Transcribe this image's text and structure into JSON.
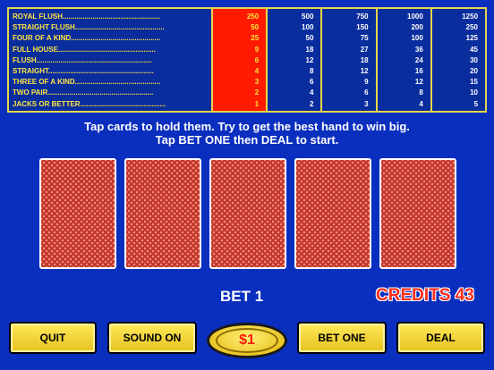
{
  "paytable": {
    "hands": [
      "ROYAL FLUSH.................................................",
      "STRAIGHT FLUSH.............................................",
      "FOUR OF A KIND.............................................",
      "FULL HOUSE.................................................",
      "FLUSH..........................................................",
      "STRAIGHT.....................................................",
      "THREE OF A KIND...........................................",
      "TWO PAIR.....................................................",
      "JACKS OR BETTER..........................................."
    ],
    "columns": [
      [
        "250",
        "50",
        "25",
        "9",
        "6",
        "4",
        "3",
        "2",
        "1"
      ],
      [
        "500",
        "100",
        "50",
        "18",
        "12",
        "8",
        "6",
        "4",
        "2"
      ],
      [
        "750",
        "150",
        "75",
        "27",
        "18",
        "12",
        "9",
        "6",
        "3"
      ],
      [
        "1000",
        "200",
        "100",
        "36",
        "24",
        "16",
        "12",
        "8",
        "4"
      ],
      [
        "1250",
        "250",
        "125",
        "45",
        "30",
        "20",
        "15",
        "10",
        "5"
      ]
    ],
    "active_column": 0,
    "colors": {
      "border": "#e8d64a",
      "active": "#ff1a00",
      "hand_text": "#ffe640"
    }
  },
  "instructions": {
    "line1": "Tap cards to hold them. Try to get the best hand to win big.",
    "line2": "Tap BET ONE then DEAL to start."
  },
  "status": {
    "bet": "BET 1",
    "credits": "CREDITS 43"
  },
  "buttons": {
    "quit": "QUIT",
    "sound": "SOUND ON",
    "coin": "$1",
    "bet_one": "BET ONE",
    "deal": "DEAL"
  },
  "theme": {
    "background": "#0a2fbf",
    "button": "#ffe640",
    "credits": "#ff2a1a"
  }
}
